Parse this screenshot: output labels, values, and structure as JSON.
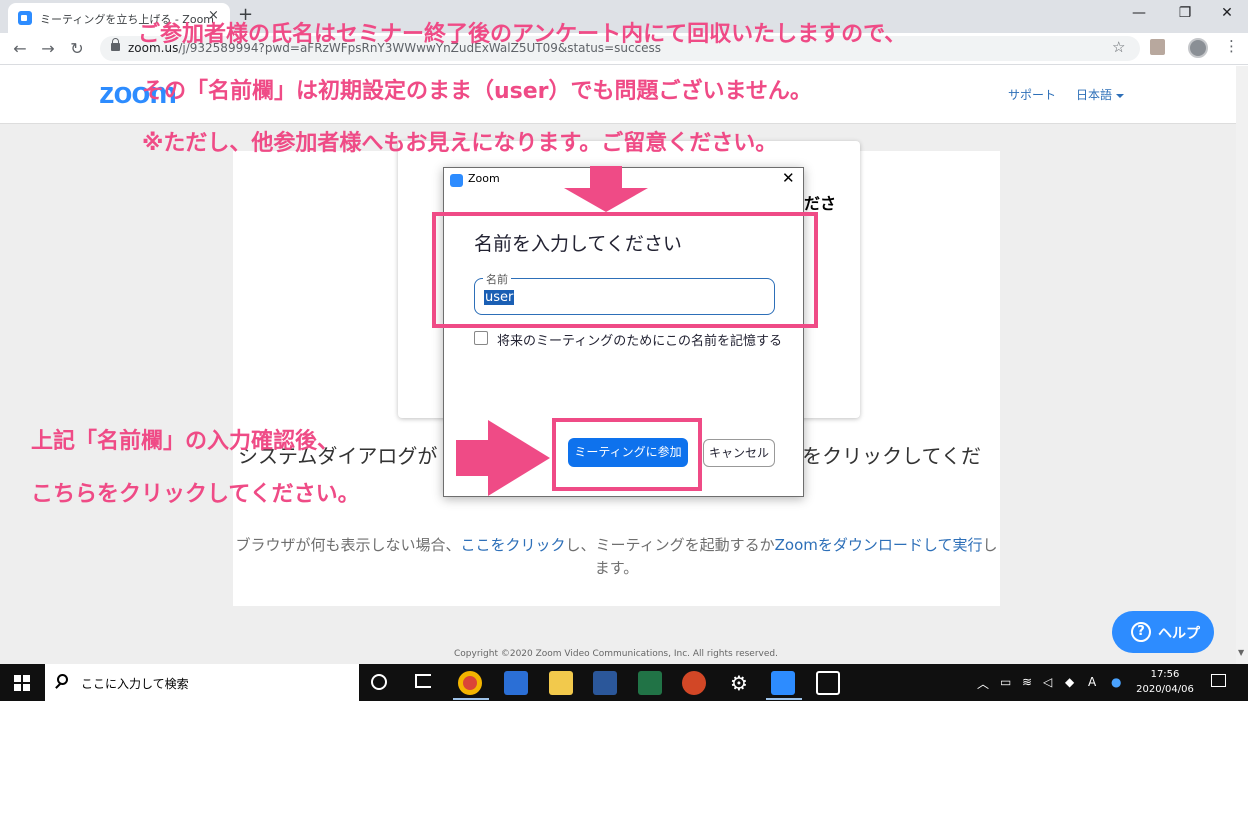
{
  "browser": {
    "tab_title": "ミーティングを立ち上げる - Zoom",
    "tab_close": "×",
    "new_tab": "+",
    "url_host": "zoom.us",
    "url_path": "/j/932589994?pwd=aFRzWFpsRnY3WWwwYnZudExWalZ5UT09&status=success",
    "window_minimize": "—",
    "window_restore": "❐",
    "window_close": "✕"
  },
  "page": {
    "logo": "zoom",
    "nav_support": "サポート",
    "nav_language": "日本語",
    "card_heading_fragment": "ださ",
    "launch_text_left": "システムダイアログが",
    "launch_text_right": "] をクリックしてくだ",
    "fallback_prefix": "ブラウザが何も表示しない場合、",
    "fallback_link1": "ここをクリック",
    "fallback_mid": "し、ミーティングを起動するか",
    "fallback_link2": "Zoomをダウンロードして実行",
    "fallback_suffix": "します。",
    "help_button": "ヘルプ",
    "copyright": "Copyright ©2020 Zoom Video Communications, Inc. All rights reserved."
  },
  "dialog": {
    "title": "Zoom",
    "close": "✕",
    "heading": "名前を入力してください",
    "name_label": "名前",
    "name_value": "user",
    "remember_label": "将来のミーティングのためにこの名前を記憶する",
    "remember_checked": false,
    "join_button": "ミーティングに参加",
    "cancel_button": "キャンセル"
  },
  "annotations": {
    "line1": "ご参加者様の氏名はセミナー終了後のアンケート内にて回収いたしますので、",
    "line2": "その「名前欄」は初期設定のまま（user）でも問題ございません。",
    "line3": "※ただし、他参加者様へもお見えになります。ご留意ください。",
    "left1": "上記「名前欄」の入力確認後、",
    "left2": "こちらをクリックしてください。",
    "color": "#ef4b86"
  },
  "taskbar": {
    "search_placeholder": "ここに入力して検索",
    "time": "17:56",
    "date": "2020/04/06",
    "ime": "A"
  },
  "colors": {
    "zoom_blue": "#2d8cff",
    "join_blue": "#0e72ed",
    "annotation_pink": "#ef4b86"
  }
}
